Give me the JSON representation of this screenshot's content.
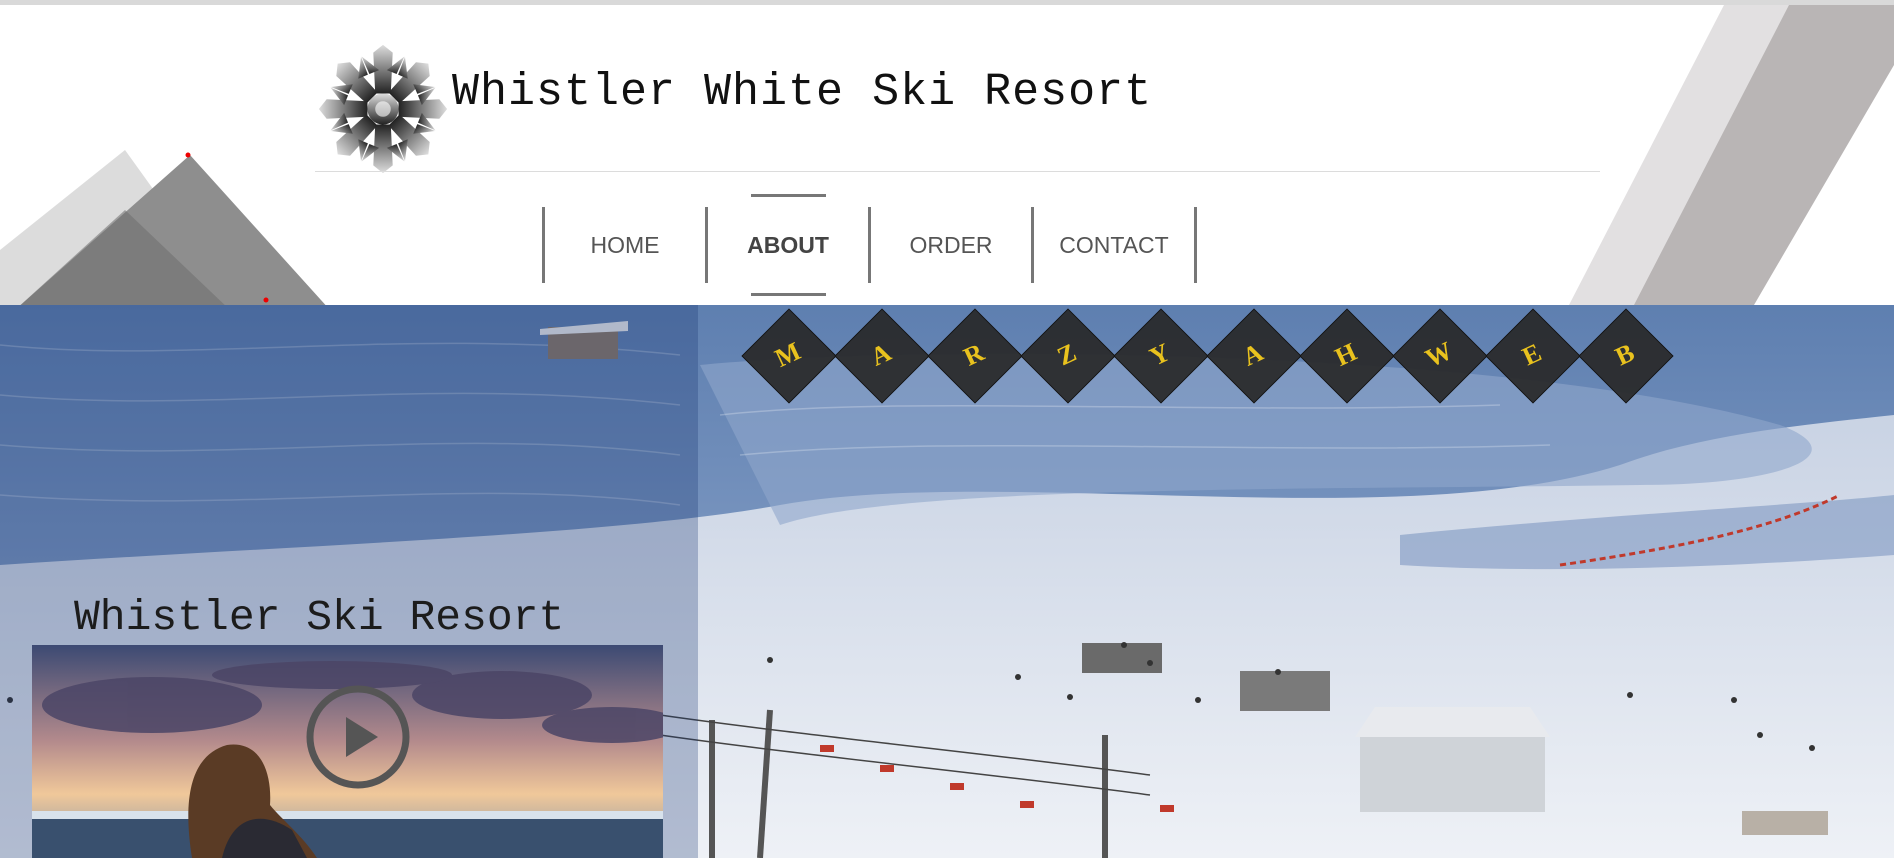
{
  "site": {
    "title": "Whistler White Ski Resort"
  },
  "nav": {
    "items": [
      {
        "label": "HOME",
        "active": false
      },
      {
        "label": "ABOUT",
        "active": true
      },
      {
        "label": "ORDER",
        "active": false
      },
      {
        "label": "CONTACT",
        "active": false
      }
    ]
  },
  "hero": {
    "letters": [
      "M",
      "A",
      "R",
      "Z",
      "Y",
      "A",
      "H",
      "W",
      "E",
      "B"
    ],
    "subtitle": "Whistler Ski Resort",
    "video": {
      "icon": "play-icon"
    }
  },
  "icons": {
    "logo": "snowflake-logo-icon",
    "play": "play-icon"
  },
  "colors": {
    "nav_separator": "#777777",
    "diamond_bg": "#2a2a2a",
    "diamond_letter": "#e9c21e",
    "deco_gray": "#8a8a8a"
  }
}
